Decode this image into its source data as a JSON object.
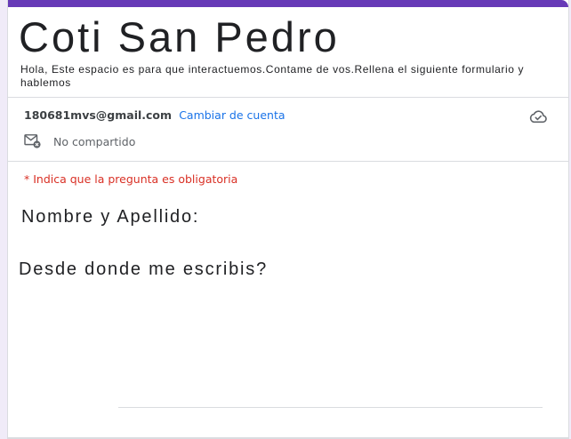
{
  "form": {
    "title": "Coti San Pedro",
    "description": "Hola, Este espacio es para que interactuemos.Contame de vos.Rellena el siguiente formulario y hablemos"
  },
  "account": {
    "email": "180681mvs@gmail.com",
    "switch_label": "Cambiar de cuenta",
    "shared_status": "No compartido"
  },
  "icons": {
    "cloud": "cloud-check-icon",
    "mail": "mail-not-shared-icon"
  },
  "required_note": "* Indica que la pregunta es obligatoria",
  "questions": [
    {
      "label": "Nombre y Apellido:",
      "value": ""
    },
    {
      "label": "Desde donde me escribis?",
      "value": ""
    }
  ],
  "colors": {
    "accent": "#673ab7",
    "link": "#1a73e8",
    "required": "#d93025"
  }
}
